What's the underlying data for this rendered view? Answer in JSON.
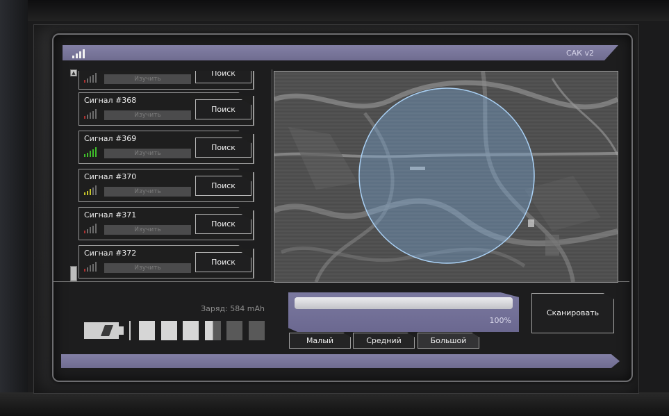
{
  "header": {
    "title": "САК v2",
    "signal_icon": "signal-strength-icon"
  },
  "signals": [
    {
      "name": "",
      "study_label": "Изучить",
      "search_label": "Поиск",
      "strength": 1,
      "color": "#b03030"
    },
    {
      "name": "Сигнал #368",
      "study_label": "Изучить",
      "search_label": "Поиск",
      "strength": 1,
      "color": "#b03030"
    },
    {
      "name": "Сигнал #369",
      "study_label": "Изучить",
      "search_label": "Поиск",
      "strength": 5,
      "color": "#3fbf2a"
    },
    {
      "name": "Сигнал #370",
      "study_label": "Изучить",
      "search_label": "Поиск",
      "strength": 3,
      "color": "#c6c42a"
    },
    {
      "name": "Сигнал #371",
      "study_label": "Изучить",
      "search_label": "Поиск",
      "strength": 1,
      "color": "#b03030"
    },
    {
      "name": "Сигнал #372",
      "study_label": "Изучить",
      "search_label": "Поиск",
      "strength": 1,
      "color": "#b03030"
    }
  ],
  "battery": {
    "label": "Заряд: 584 mAh",
    "cells_total": 6,
    "cells_full": 3.5,
    "icon": "battery-icon"
  },
  "scan": {
    "progress_percent": 100,
    "progress_text": "100%",
    "sizes": [
      "Малый",
      "Средний",
      "Большой"
    ],
    "selected_size": "Большой",
    "button_label": "Сканировать"
  },
  "colors": {
    "accent": "#7b79a0",
    "scan_area": "#7fb0e0"
  }
}
